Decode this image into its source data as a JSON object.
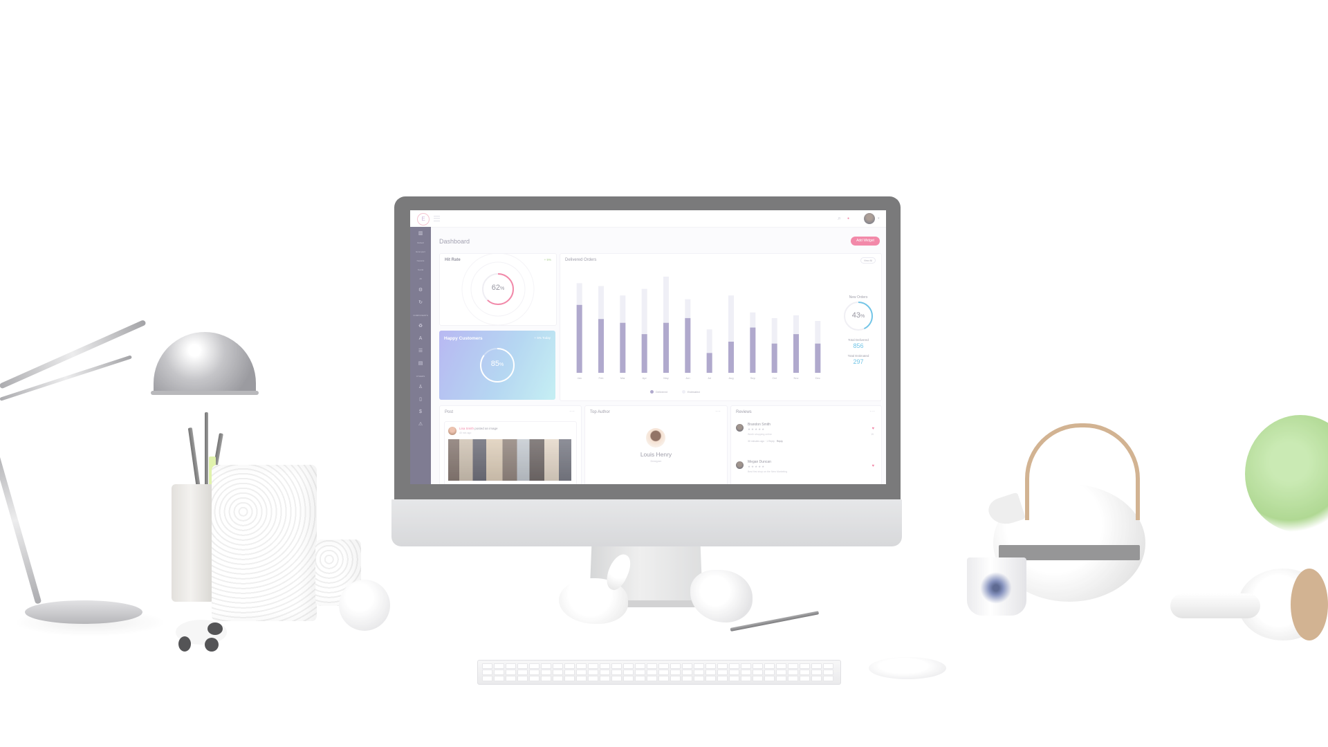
{
  "app": {
    "logo_letter": "E",
    "page_title": "Dashboard",
    "add_widget_label": "Add Widget"
  },
  "sidebar": {
    "items": [
      {
        "label": "Default"
      },
      {
        "label": "Ecompact"
      },
      {
        "label": "Newslot"
      },
      {
        "label": "Social"
      },
      {
        "label": "All"
      }
    ],
    "section_components": "COMPONENTS",
    "section_others": "OTHERS"
  },
  "hit_rate": {
    "title": "Hit Rate",
    "change": "+ 5%",
    "value": "62",
    "unit": "%",
    "fraction": 0.62,
    "color": "#f06f96"
  },
  "happy_customers": {
    "title": "Happy Customers",
    "change": "+ 5% Today",
    "value": "85",
    "unit": "%",
    "fraction": 0.85
  },
  "delivered_orders": {
    "title": "Delivered Orders",
    "view_all": "View All",
    "new_orders": {
      "label": "New Orders",
      "value": "43",
      "unit": "%",
      "fraction": 0.43,
      "color": "#53b9e2"
    },
    "total_delivered": {
      "label": "Total Delivered",
      "value": "856"
    },
    "total_estimated": {
      "label": "Total Estimated",
      "value": "297"
    }
  },
  "chart_data": {
    "type": "bar",
    "categories": [
      "Jan",
      "Feb",
      "Mar",
      "Apr",
      "May",
      "Jun",
      "Jul",
      "Aug",
      "Sep",
      "Oct",
      "Nov",
      "Dec"
    ],
    "series": [
      {
        "name": "Delivered",
        "values": [
          72,
          57,
          53,
          41,
          53,
          58,
          21,
          33,
          48,
          31,
          41,
          31
        ],
        "color": "#9f97c2"
      },
      {
        "name": "Estimated",
        "values": [
          95,
          92,
          82,
          89,
          102,
          78,
          46,
          82,
          64,
          58,
          61,
          55
        ],
        "color": "#ececf4"
      }
    ],
    "ylim": [
      0,
      110
    ],
    "legend": "bottom-center",
    "grid": false
  },
  "post": {
    "title": "Post",
    "author": "Lisa Smith",
    "action": "posted an image",
    "time": "40 min ago"
  },
  "top_author": {
    "title": "Top Author",
    "name": "Louis Henry",
    "role": "Designer"
  },
  "reviews": {
    "title": "Reviews",
    "items": [
      {
        "name": "Brandon Smith",
        "stars": "★★★★★",
        "text": "Worth shopping online",
        "time": "30 minutes ago",
        "replies": "1 Reply",
        "action": "Reply",
        "likes": "15"
      },
      {
        "name": "Megan Duncan",
        "stars": "★★★★★",
        "text": "Best first shop on the New Marketing"
      }
    ]
  },
  "icons": {
    "search": "⌕",
    "bell": "●",
    "menu": "⋯",
    "heart": "♥"
  }
}
